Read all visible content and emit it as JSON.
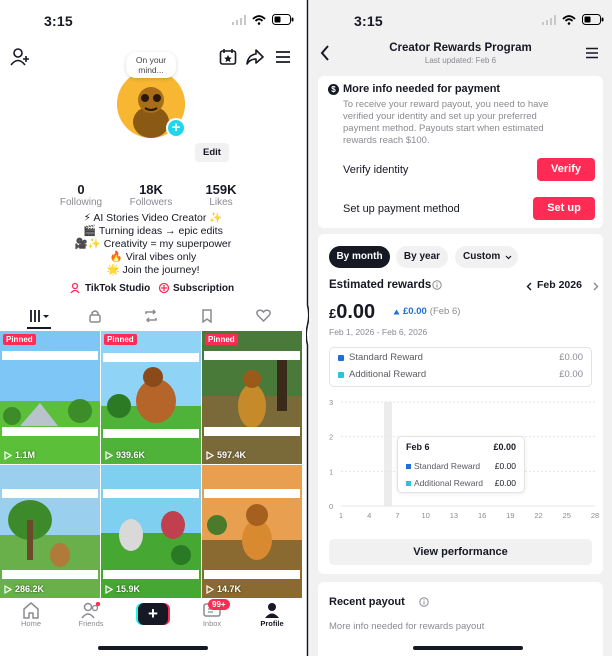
{
  "left": {
    "status_time": "3:15",
    "note_text": "On your mind...",
    "edit_label": "Edit",
    "stats": [
      {
        "value": "0",
        "label": "Following"
      },
      {
        "value": "18K",
        "label": "Followers"
      },
      {
        "value": "159K",
        "label": "Likes"
      }
    ],
    "bio": [
      "⚡ AI Stories Video Creator ✨",
      "🎬 Turning ideas → epic edits",
      "🎥✨ Creativity = my superpower",
      "🔥 Viral vibes only",
      "🌟 Join the journey!"
    ],
    "links": {
      "studio": "TikTok Studio",
      "subscription": "Subscription"
    },
    "videos": [
      {
        "views": "1.1M",
        "pinned": "Pinned"
      },
      {
        "views": "939.6K",
        "pinned": "Pinned"
      },
      {
        "views": "597.4K",
        "pinned": "Pinned"
      },
      {
        "views": "286.2K",
        "pinned": ""
      },
      {
        "views": "15.9K",
        "pinned": ""
      },
      {
        "views": "14.7K",
        "pinned": ""
      }
    ],
    "nav": {
      "home": "Home",
      "friends": "Friends",
      "inbox": "Inbox",
      "inbox_badge": "99+",
      "profile": "Profile"
    }
  },
  "right": {
    "status_time": "3:15",
    "header": {
      "title": "Creator Rewards Program",
      "subtitle": "Last updated: Feb 6"
    },
    "info": {
      "title": "More info needed for payment",
      "body": "To receive your reward payout, you need to have verified your identity and set up your preferred payment method. Payouts start when estimated rewards reach $100.",
      "verify_label": "Verify identity",
      "verify_button": "Verify",
      "payment_label": "Set up payment method",
      "payment_button": "Set up"
    },
    "filters": {
      "month": "By month",
      "year": "By year",
      "custom": "Custom"
    },
    "rewards": {
      "title": "Estimated rewards",
      "month": "Feb 2026",
      "currency": "£",
      "amount": "0.00",
      "delta": "£0.00",
      "delta_note": "(Feb 6)",
      "range": "Feb 1, 2026 - Feb 6, 2026",
      "legend": [
        {
          "name": "Standard Reward",
          "value": "£0.00",
          "color": "#1e6fd9"
        },
        {
          "name": "Additional Reward",
          "value": "£0.00",
          "color": "#25c6d9"
        }
      ],
      "tooltip": {
        "date": "Feb 6",
        "total": "£0.00",
        "rows": [
          {
            "name": "Standard Reward",
            "value": "£0.00"
          },
          {
            "name": "Additional Reward",
            "value": "£0.00"
          }
        ]
      },
      "view_button": "View performance"
    },
    "chart_data": {
      "type": "bar",
      "x_ticks": [
        "1",
        "4",
        "7",
        "10",
        "13",
        "16",
        "19",
        "22",
        "25",
        "28"
      ],
      "y_ticks": [
        "0",
        "1",
        "2",
        "3"
      ],
      "ylim": [
        0,
        3
      ],
      "xlim": [
        1,
        28
      ],
      "highlight_x": 6,
      "series": [
        {
          "name": "Standard Reward",
          "values": [
            0,
            0,
            0,
            0,
            0,
            0
          ]
        },
        {
          "name": "Additional Reward",
          "values": [
            0,
            0,
            0,
            0,
            0,
            0
          ]
        }
      ]
    },
    "payout": {
      "title": "Recent payout",
      "body": "More info needed for rewards payout"
    }
  }
}
